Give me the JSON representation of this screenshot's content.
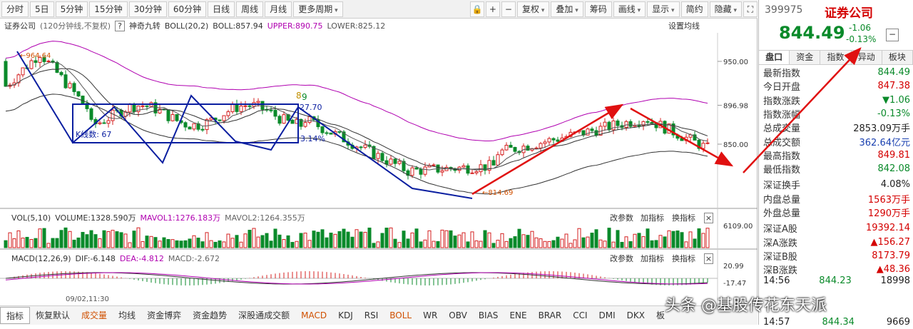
{
  "toolbar": {
    "periods": [
      "分时",
      "5日",
      "5分钟",
      "15分钟",
      "30分钟",
      "60分钟",
      "日线",
      "周线",
      "月线",
      "更多周期"
    ],
    "right": [
      "复权",
      "叠加",
      "筹码",
      "画线",
      "显示",
      "简约",
      "隐藏"
    ],
    "icons": [
      "lock-icon",
      "plus-icon",
      "minus-icon"
    ],
    "fullscreen": "fullscreen-icon"
  },
  "chart": {
    "name": "证券公司",
    "period": "(120分钟线,不复权)",
    "indicator": "神奇九转",
    "boll": "BOLL(20,2)",
    "boll_val": "BOLL:857.94",
    "upper": "UPPER:890.75",
    "lower": "LOWER:825.12",
    "setting": "设置均线",
    "price_ticks": [
      "950.00",
      "896.98",
      "850.00"
    ],
    "high_label": "964.64",
    "low_label": "814.69",
    "kline_count": "K线数: 67",
    "box_top": "27.70",
    "box_pct": "3.14%",
    "nine": "9",
    "eight": "8"
  },
  "vol": {
    "title": "VOL(5,10)",
    "volume": "VOLUME:1328.590万",
    "mavol1": "MAVOL1:1276.183万",
    "mavol2": "MAVOL2:1264.355万",
    "tick": "6109.00",
    "buttons": [
      "改参数",
      "加指标",
      "换指标"
    ]
  },
  "macd": {
    "title": "MACD(12,26,9)",
    "dif": "DIF:-6.148",
    "dea": "DEA:-4.812",
    "macd": "MACD:-2.672",
    "ticks": [
      "20.99",
      "-17.47"
    ],
    "buttons": [
      "改参数",
      "加指标",
      "换指标"
    ],
    "date": "09/02,11:30"
  },
  "bottom": [
    "指标",
    "恢复默认",
    "成交量",
    "均线",
    "资金博弈",
    "资金趋势",
    "深股通成交额",
    "MACD",
    "KDJ",
    "RSI",
    "BOLL",
    "WR",
    "OBV",
    "BIAS",
    "ENE",
    "BRAR",
    "CCI",
    "DMI",
    "DKX",
    "板"
  ],
  "side": {
    "code": "399975",
    "name": "证券公司",
    "price": "844.49",
    "change": "-1.06",
    "pct": "-0.13%",
    "tabs": [
      "盘口",
      "资金",
      "指数",
      "异动",
      "板块"
    ],
    "rows": [
      [
        "最新指数",
        "844.49",
        "grn"
      ],
      [
        "今日开盘",
        "847.38",
        "red"
      ],
      [
        "指数涨跌",
        "▼1.06",
        "grn"
      ],
      [
        "指数涨幅",
        "-0.13%",
        "grn"
      ],
      [
        "总成交量",
        "2853.09万手",
        "dk"
      ],
      [
        "总成交额",
        "362.64亿元",
        "blu"
      ],
      [
        "最高指数",
        "849.81",
        "red"
      ],
      [
        "最低指数",
        "842.08",
        "grn"
      ],
      [
        "深证换手",
        "4.08%",
        "dk"
      ],
      [
        "内盘总量",
        "1563万手",
        "red"
      ],
      [
        "外盘总量",
        "1290万手",
        "red"
      ],
      [
        "深证A股",
        "19392.14",
        "red"
      ],
      [
        "深A涨跌",
        "▲156.27",
        "red"
      ],
      [
        "深证B股",
        "8173.79",
        "red"
      ],
      [
        "深B涨跌",
        "▲48.36",
        "red"
      ]
    ],
    "ticks": [
      [
        "14:56",
        "844.23",
        "18998"
      ],
      [
        "14:57",
        "844.34",
        "9669"
      ]
    ]
  },
  "watermark": "头条 @基股传花东天派"
}
